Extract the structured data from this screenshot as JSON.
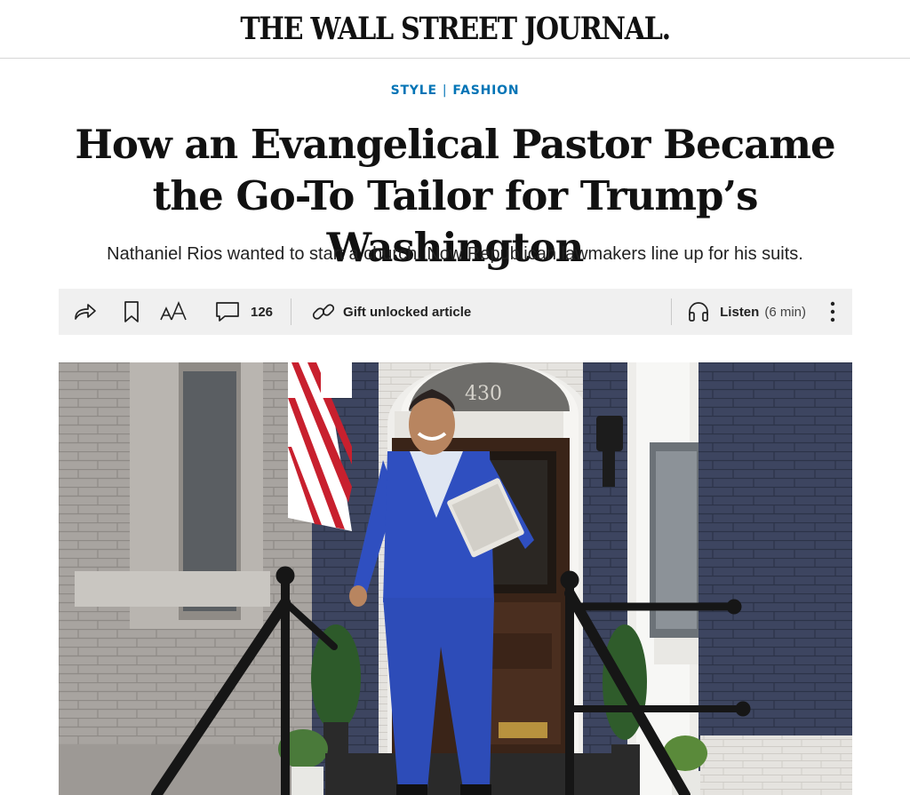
{
  "masthead": {
    "title": "THE WALL STREET JOURNAL."
  },
  "breadcrumb": {
    "section": "STYLE",
    "separator": "|",
    "subsection": "FASHION"
  },
  "article": {
    "headline": "How an Evangelical Pastor Became the Go-To Tailor for Trump’s Washington",
    "dek": "Nathaniel Rios wanted to start a church. Now Republican lawmakers line up for his suits."
  },
  "toolbar": {
    "share_icon": "share-arrow-icon",
    "bookmark_icon": "bookmark-icon",
    "text_size_label": "AA",
    "comments_icon": "comment-bubble-icon",
    "comments_count": "126",
    "gift_icon": "link-icon",
    "gift_label": "Gift unlocked article",
    "listen_icon": "headphones-icon",
    "listen_label": "Listen",
    "listen_duration": "(6 min)",
    "more_icon": "more-vertical-icon"
  },
  "hero": {
    "door_number": "430"
  },
  "colors": {
    "accent": "#0274b6",
    "toolbar_bg": "#f0f0f0",
    "suit": "#2f4fc0"
  }
}
